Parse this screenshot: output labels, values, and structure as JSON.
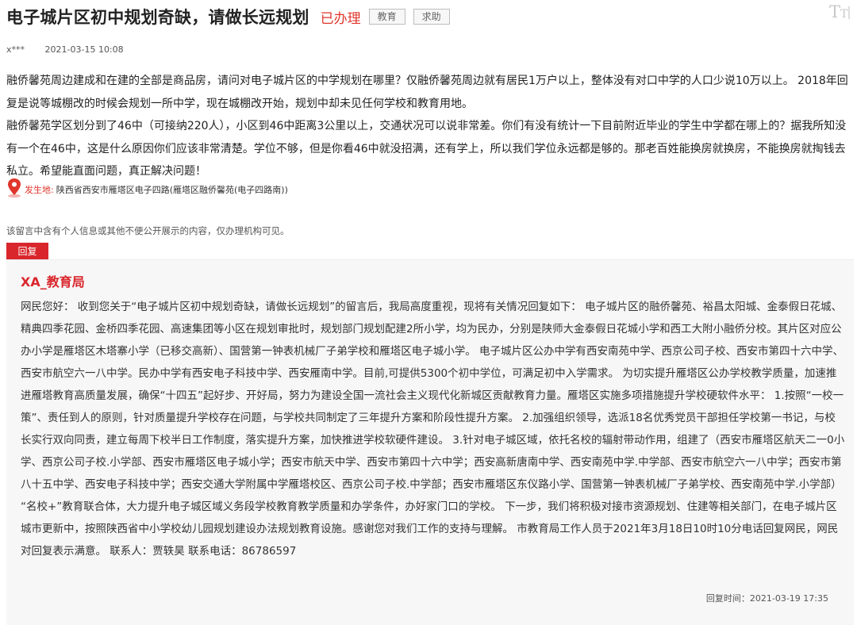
{
  "header": {
    "title": "电子城片区初中规划奇缺，请做长远规划",
    "status": "已办理",
    "tags": [
      "教育",
      "求助"
    ],
    "font_size_icon": "font-size-icon"
  },
  "meta": {
    "author": "x***",
    "date": "2021-03-15 10:08"
  },
  "message": {
    "paragraphs": [
      " 融侨馨苑周边建成和在建的全部是商品房，请问对电子城片区的中学规划在哪里？仅融侨馨苑周边就有居民1万户以上，整体没有对口中学的人口少说10万以上。 2018年回复是说等城棚改的时候会规划一所中学，现在城棚改开始，规划中却未见任何学校和教育用地。",
      "融侨馨苑学区划分到了46中（可接纳220人），小区到46中距离3公里以上，交通状况可以说非常差。你们有没有统计一下目前附近毕业的学生中学都在哪上的？据我所知没有一个在46中，这是什么原因你们应该非常清楚。学位不够，但是你看46中就没招满，还有学上，所以我们学位永远都是够的。那老百姓能换房就换房，不能换房就掏钱去私立。希望能直面问题，真正解决问题！"
    ]
  },
  "location": {
    "icon": "location-pin-icon",
    "label": "发生地:",
    "value": "陕西省西安市雁塔区电子四路(雁塔区融侨馨苑(电子四路南))"
  },
  "notice": "该留言中含有个人信息或其他不便公开展示的内容，仅办理机构可见。",
  "reply": {
    "tab_label": "回复",
    "org": "XA_教育局",
    "content": "网民您好： 收到您关于“电子城片区初中规划奇缺，请做长远规划”的留言后，我局高度重视，现将有关情况回复如下： 电子城片区的融侨馨苑、裕昌太阳城、金泰假日花城、精典四季花园、金桥四季花园、高速集团等小区在规划审批时，规划部门规划配建2所小学，均为民办，分别是陕师大金泰假日花城小学和西工大附小融侨分校。其片区对应公办小学是雁塔区木塔寨小学（已移交高新）、国营第一钟表机械厂子弟学校和雁塔区电子城小学。 电子城片区公办中学有西安南苑中学、西京公司子校、西安市第四十六中学、西安市航空六一八中学。民办中学有西安电子科技中学、西安雁南中学。目前,可提供5300个初中学位，可满足初中入学需求。 为切实提升雁塔区公办学校教学质量，加速推进雁塔教育高质量发展，确保“十四五”起好步、开好局，努力为建设全国一流社会主义现代化新城区贡献教育力量。雁塔区实施多项措施提升学校硬软件水平： 1.按照“一校一策”、责任到人的原则，针对质量提升学校存在问题，与学校共同制定了三年提升方案和阶段性提升方案。 2.加强组织领导，选派18名优秀党员干部担任学校第一书记，与校长实行双向同责，建立每周下校半日工作制度，落实提升方案，加快推进学校软硬件建设。 3.针对电子城区域，依托名校的辐射带动作用，组建了（西安市雁塔区航天二一0小学、西京公司子校.小学部、西安市雁塔区电子城小学；西安市航天中学、西安市第四十六中学；西安高新唐南中学、西安南苑中学.中学部、西安市航空六一八中学；西安市第八十五中学、西安电子科技中学；西安交通大学附属中学雁塔校区、西京公司子校.中学部；西安市雁塔区东仪路小学、国营第一钟表机械厂子弟学校、西安南苑中学.小学部） “名校+”教育联合体，大力提升电子城区域义务段学校教育教学质量和办学条件，办好家门口的学校。 下一步，我们将积极对接市资源规划、住建等相关部门，在电子城片区城市更新中，按照陕西省中小学校幼儿园规划建设办法规划教育设施。感谢您对我们工作的支持与理解。 市教育局工作人员于2021年3月18日10时10分电话回复网民，网民对回复表示满意。 联系人：贾轶昊 联系电话：86786597",
    "time": "回复时间：2021-03-19 17:35"
  },
  "colors": {
    "accent": "#d9262c",
    "status": "#e0352b",
    "reply_bg": "#f7f7f7"
  }
}
